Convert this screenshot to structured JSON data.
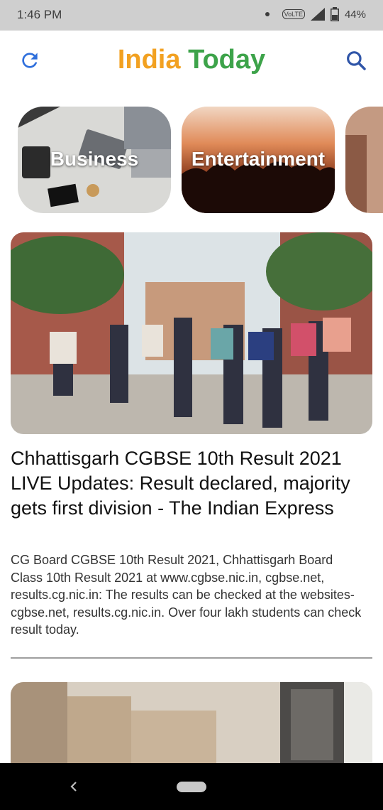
{
  "status_bar": {
    "time": "1:46 PM",
    "battery": "44%",
    "network_badge": "VoLTE"
  },
  "app_bar": {
    "title_part1": "India",
    "title_part2": "Today",
    "refresh_icon": "refresh-icon",
    "search_icon": "search-icon"
  },
  "categories": [
    {
      "label": "Business"
    },
    {
      "label": "Entertainment"
    }
  ],
  "articles": [
    {
      "headline": "Chhattisgarh CGBSE 10th Result 2021 LIVE Updates: Result declared, majority gets first division - The Indian Express",
      "summary": "CG Board CGBSE 10th Result 2021, Chhattisgarh Board Class 10th Result 2021 at www.cgbse.nic.in, cgbse.net, results.cg.nic.in: The results can be checked at the websites- cgbse.net, results.cg.nic.in. Over four lakh students can check result today."
    }
  ],
  "colors": {
    "title_orange": "#f2a121",
    "title_green": "#3da34a",
    "icon_blue": "#2f6fdc"
  }
}
